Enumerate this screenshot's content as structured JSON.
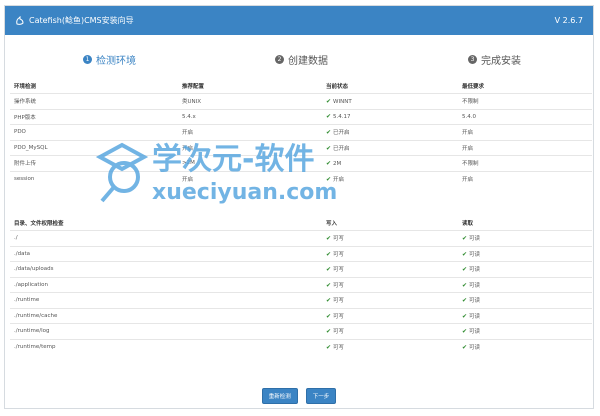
{
  "header": {
    "title": "Catefish(鲶鱼)CMS安装向导",
    "version": "V 2.6.7"
  },
  "steps": [
    {
      "num": "1",
      "label": "检测环境"
    },
    {
      "num": "2",
      "label": "创建数据"
    },
    {
      "num": "3",
      "label": "完成安装"
    }
  ],
  "env": {
    "headers": [
      "环境检测",
      "推荐配置",
      "当前状态",
      "最低要求"
    ],
    "rows": [
      {
        "name": "操作系统",
        "rec": "类UNIX",
        "cur": "WINNT",
        "min": "不限制"
      },
      {
        "name": "PHP版本",
        "rec": "5.4.x",
        "cur": "5.4.17",
        "min": "5.4.0"
      },
      {
        "name": "PDO",
        "rec": "开启",
        "cur": "已开启",
        "min": "开启"
      },
      {
        "name": "PDO_MySQL",
        "rec": "开启",
        "cur": "已开启",
        "min": "开启"
      },
      {
        "name": "附件上传",
        "rec": ">2M",
        "cur": "2M",
        "min": "不限制"
      },
      {
        "name": "session",
        "rec": "开启",
        "cur": "开启",
        "min": "开启"
      }
    ]
  },
  "dirs": {
    "headers": [
      "目录、文件权限检查",
      "写入",
      "读取"
    ],
    "write_label": "可写",
    "read_label": "可读",
    "rows": [
      "./",
      "./data",
      "./data/uploads",
      "./application",
      "./runtime",
      "./runtime/cache",
      "./runtime/log",
      "./runtime/temp"
    ]
  },
  "buttons": {
    "recheck": "重新检测",
    "next": "下一步"
  },
  "watermark": {
    "cn": "学次元-软件",
    "en": "xueciyuan.com"
  },
  "colors": {
    "primary": "#3b84c4",
    "check": "#2e8b2e"
  }
}
